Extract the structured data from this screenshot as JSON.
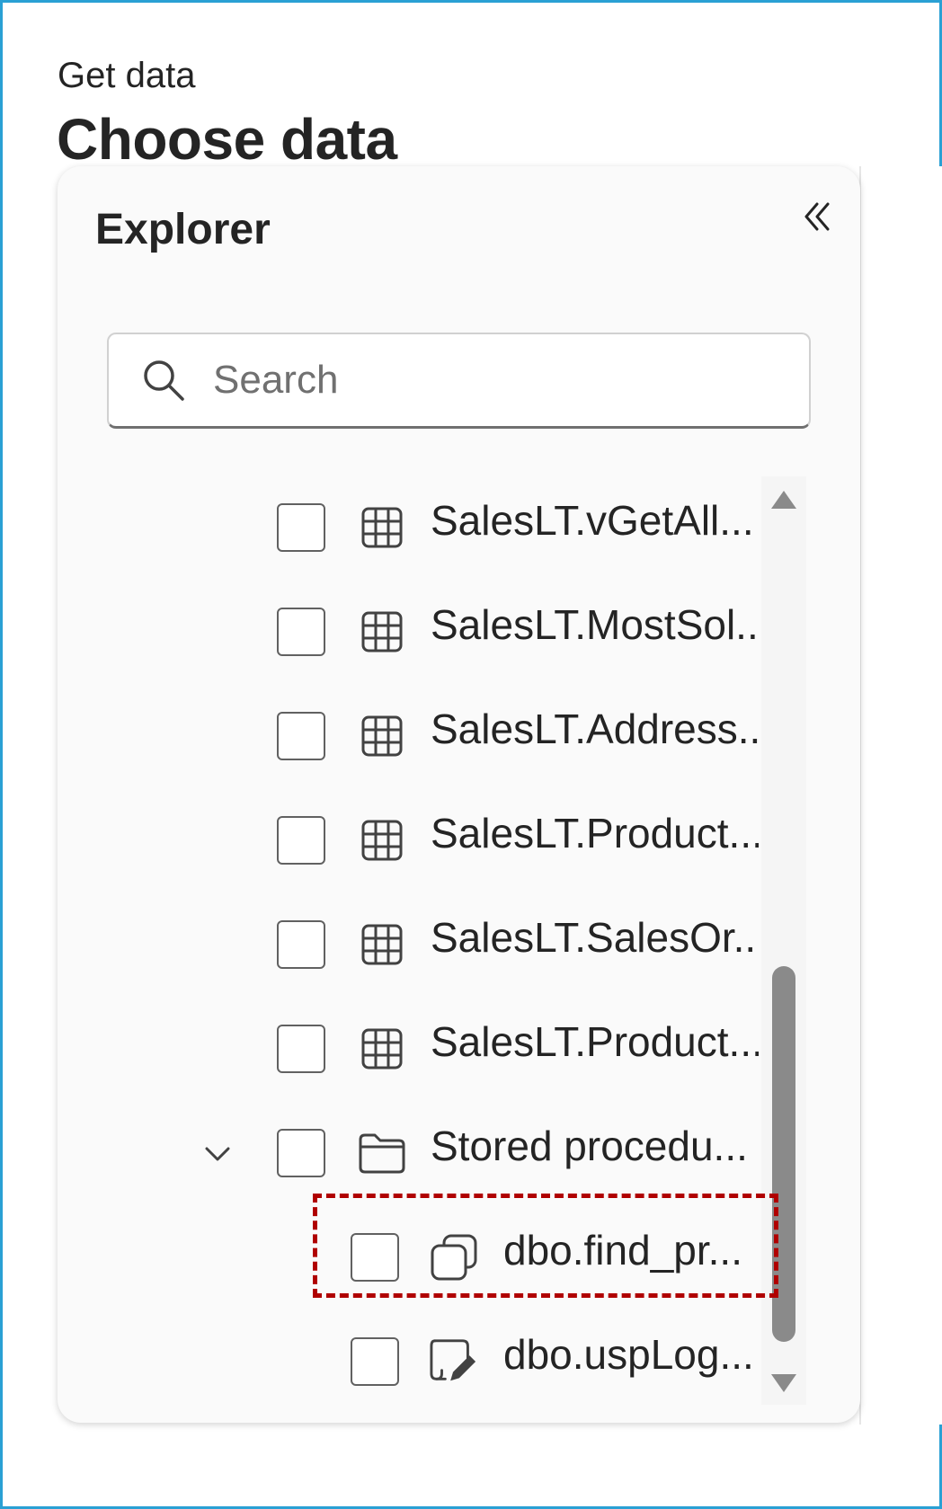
{
  "header": {
    "subtitle": "Get data",
    "title": "Choose data"
  },
  "explorer": {
    "title": "Explorer",
    "collapse_icon": "double-chevron-left-icon",
    "search": {
      "placeholder": "Search",
      "value": ""
    },
    "items": [
      {
        "label": "SalesLT.vGetAll...",
        "icon": "table-icon",
        "checked": false
      },
      {
        "label": "SalesLT.MostSol...",
        "icon": "table-icon",
        "checked": false
      },
      {
        "label": "SalesLT.Address...",
        "icon": "table-icon",
        "checked": false
      },
      {
        "label": "SalesLT.Product...",
        "icon": "table-icon",
        "checked": false
      },
      {
        "label": "SalesLT.SalesOr...",
        "icon": "table-icon",
        "checked": false
      },
      {
        "label": "SalesLT.Product...",
        "icon": "table-icon",
        "checked": false
      },
      {
        "label": "Stored procedu...",
        "icon": "folder-icon",
        "checked": false,
        "expanded": true
      },
      {
        "label": "dbo.find_pr...",
        "icon": "stored-procedure-icon",
        "checked": false
      },
      {
        "label": "dbo.uspLog...",
        "icon": "edit-script-icon",
        "checked": false
      }
    ]
  },
  "colors": {
    "frame_border": "#2aa0d4",
    "highlight": "#b00000",
    "scroll_thumb": "#8a8a8a"
  }
}
